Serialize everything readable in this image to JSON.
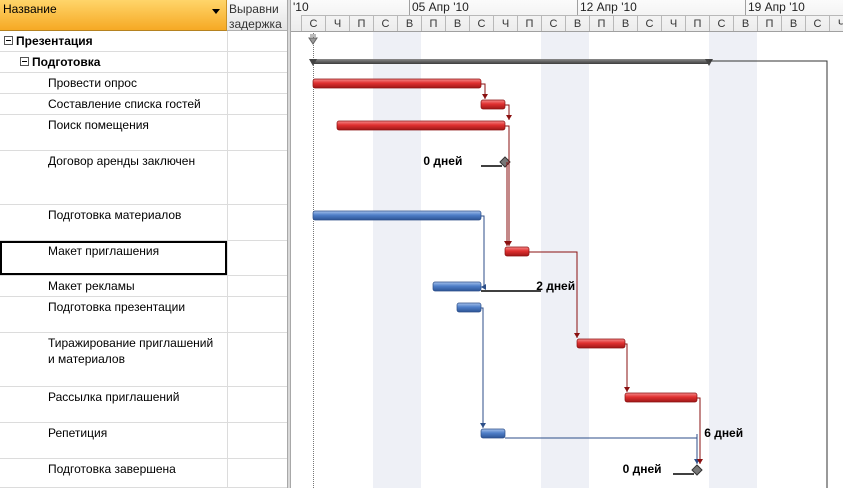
{
  "columns": {
    "name": "Название",
    "leveling": "Выравнивание задержка"
  },
  "leveling_lines": [
    "Выравни",
    "задержка"
  ],
  "timescale": {
    "weeks": [
      {
        "label": "'10"
      },
      {
        "label": "05 Апр '10"
      },
      {
        "label": "12 Апр '10"
      },
      {
        "label": "19 Апр '10"
      }
    ],
    "days": [
      "С",
      "Ч",
      "П",
      "С",
      "В",
      "П",
      "В",
      "С",
      "Ч",
      "П",
      "С",
      "В",
      "П",
      "В",
      "С",
      "Ч",
      "П",
      "С",
      "В",
      "П",
      "В",
      "С",
      "Ч"
    ]
  },
  "tasks": [
    {
      "name": "Презентация",
      "bold": true,
      "collapse": true
    },
    {
      "name": "Подготовка",
      "bold": true,
      "collapse": true
    },
    {
      "name": "Провести опрос"
    },
    {
      "name": "Составление списка гостей"
    },
    {
      "name": "Поиск помещения"
    },
    {
      "name": "Договор аренды заключен"
    },
    {
      "name": "Подготовка материалов"
    },
    {
      "name": "Макет приглашения",
      "selected": true
    },
    {
      "name": "Макет рекламы"
    },
    {
      "name": "Подготовка презентации"
    },
    {
      "name": "Тиражирование приглашений\nи материалов",
      "lines": [
        "Тиражирование приглашений",
        "и материалов"
      ]
    },
    {
      "name": "Рассылка приглашений"
    },
    {
      "name": "Репетиция"
    },
    {
      "name": "Подготовка завершена"
    }
  ],
  "gantt_labels": {
    "lease_slack": "0 дней",
    "ad_slack": "2 дней",
    "rehearsal_slack": "6 дней",
    "finish_slack": "0 дней"
  },
  "colors": {
    "critical": "#e03030",
    "noncritical": "#4f7fc8",
    "summary": "#3c3c3c",
    "header_accent": "#f6a924",
    "nonworking": "#eef0f6"
  },
  "bars": {
    "summaries": [
      {
        "task": "Презентация",
        "start": 0.0,
        "end": 0.0,
        "type": "milestone"
      },
      {
        "task": "Подготовка",
        "start": 0.0,
        "end": 16.5,
        "type": "summary"
      }
    ],
    "tasks": [
      {
        "task": "Провести опрос",
        "start": 0.0,
        "end": 7.0,
        "critical": true
      },
      {
        "task": "Составление списка гостей",
        "start": 7.0,
        "end": 8.0,
        "critical": true
      },
      {
        "task": "Поиск помещения",
        "start": 1.0,
        "end": 8.0,
        "critical": true
      },
      {
        "task": "Договор аренды заключен",
        "start": 8.0,
        "end": 8.0,
        "critical": false,
        "milestone": true
      },
      {
        "task": "Подготовка материалов",
        "start": 0.0,
        "end": 7.0,
        "critical": false
      },
      {
        "task": "Макет приглашения",
        "start": 8.0,
        "end": 9.0,
        "critical": true
      },
      {
        "task": "Макет рекламы",
        "start": 5.0,
        "end": 7.0,
        "critical": false
      },
      {
        "task": "Подготовка презентации",
        "start": 6.0,
        "end": 7.0,
        "critical": false
      },
      {
        "task": "Тиражирование приглашений\nи материалов",
        "start": 11.0,
        "end": 13.0,
        "critical": true
      },
      {
        "task": "Рассылка приглашений",
        "start": 13.0,
        "end": 16.0,
        "critical": true
      },
      {
        "task": "Репетиция",
        "start": 7.0,
        "end": 8.0,
        "critical": false
      },
      {
        "task": "Подготовка завершена",
        "start": 16.0,
        "end": 16.0,
        "critical": false,
        "milestone": true
      }
    ]
  }
}
